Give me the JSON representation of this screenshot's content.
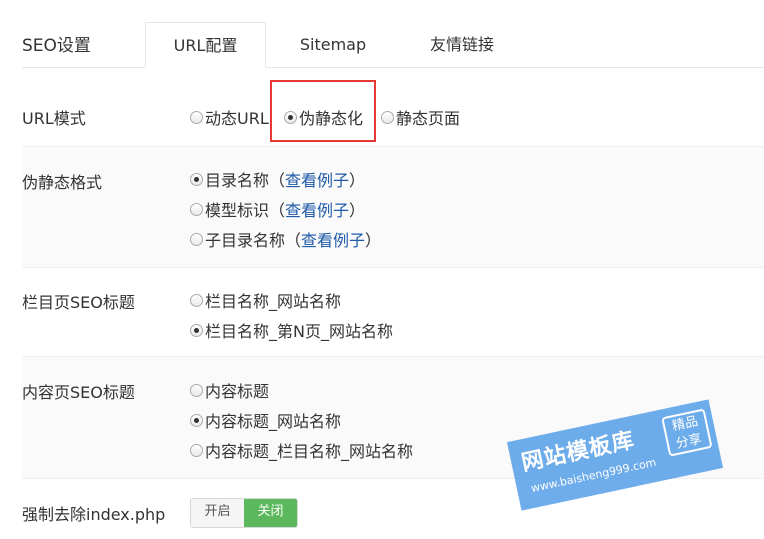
{
  "header": {
    "title": "SEO设置",
    "tabs": [
      "URL配置",
      "Sitemap",
      "友情链接"
    ]
  },
  "url_mode": {
    "label": "URL模式",
    "options": [
      "动态URL",
      "伪静态化",
      "静态页面"
    ],
    "selected": "伪静态化"
  },
  "rewrite_format": {
    "label": "伪静态格式",
    "options": [
      "目录名称",
      "模型标识",
      "子目录名称"
    ],
    "example_link": "查看例子",
    "paren_open": "（",
    "paren_close": "）",
    "selected": "目录名称"
  },
  "column_seo_title": {
    "label": "栏目页SEO标题",
    "options": [
      "栏目名称_网站名称",
      "栏目名称_第N页_网站名称"
    ],
    "selected": "栏目名称_第N页_网站名称"
  },
  "content_seo_title": {
    "label": "内容页SEO标题",
    "options": [
      "内容标题",
      "内容标题_网站名称",
      "内容标题_栏目名称_网站名称"
    ],
    "selected": "内容标题_网站名称"
  },
  "remove_index": {
    "label": "强制去除index.php",
    "on_label": "开启",
    "off_label": "关闭",
    "state": "关闭"
  },
  "watermark": {
    "main": "网站模板库",
    "url": "www.baisheng999.com",
    "badge_line1": "精品",
    "badge_line2": "分享"
  },
  "colors": {
    "link": "#1e5aa8",
    "highlight_border": "#e53935",
    "switch_active": "#5cb85c",
    "watermark": "#4f9be8"
  }
}
